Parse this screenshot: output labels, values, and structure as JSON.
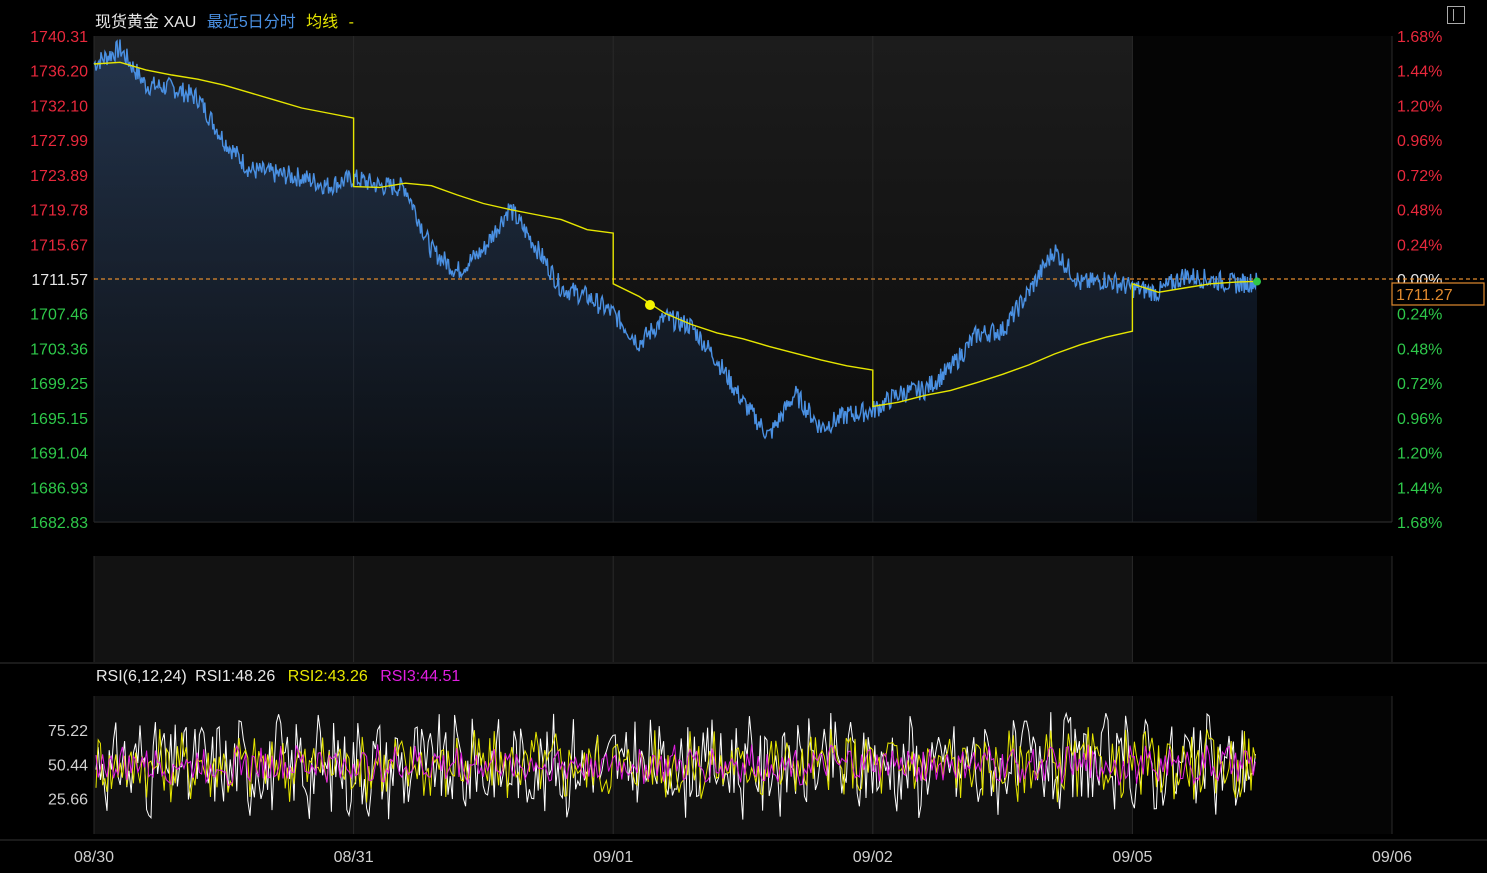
{
  "header": {
    "instrument": "现货黄金 XAU",
    "period": "最近5日分时",
    "avg_label": "均线",
    "avg_marker": "-"
  },
  "rsi_header": {
    "name": "RSI(6,12,24)",
    "rsi1": "RSI1:48.26",
    "rsi2": "RSI2:43.26",
    "rsi3": "RSI3:44.51"
  },
  "colors": {
    "price_line": "#4a90e2",
    "avg_line": "#e6e600",
    "up": "#e8283c",
    "down": "#2ec84a",
    "rsi1": "#ffffff",
    "rsi2": "#e6e600",
    "rsi3": "#e01ee0",
    "prev_close_line": "#e08a2e",
    "grid": "#2a2a2a"
  },
  "chart_data": [
    {
      "type": "line",
      "title": "现货黄金 XAU 最近5日分时",
      "x_categories": [
        "08/30",
        "08/31",
        "09/01",
        "09/02",
        "09/05",
        "09/06"
      ],
      "prev_close": 1711.57,
      "last_price": "1711.27",
      "ylim": [
        1682.83,
        1740.31
      ],
      "y_ticks_left": [
        "1740.31",
        "1736.20",
        "1732.10",
        "1727.99",
        "1723.89",
        "1719.78",
        "1715.67",
        "1711.57",
        "1707.46",
        "1703.36",
        "1699.25",
        "1695.15",
        "1691.04",
        "1686.93",
        "1682.83"
      ],
      "y_ticks_right": [
        "1.68%",
        "1.44%",
        "1.20%",
        "0.96%",
        "0.72%",
        "0.48%",
        "0.24%",
        "0.00%",
        "0.24%",
        "0.48%",
        "0.72%",
        "0.96%",
        "1.20%",
        "1.44%",
        "1.68%"
      ],
      "series": [
        {
          "name": "现货黄金 XAU",
          "x": [
            0.0,
            0.1,
            0.2,
            0.3,
            0.4,
            0.5,
            0.6,
            0.7,
            0.8,
            0.9,
            1.0,
            1.1,
            1.2,
            1.3,
            1.4,
            1.5,
            1.6,
            1.7,
            1.8,
            1.9,
            2.0,
            2.1,
            2.2,
            2.3,
            2.4,
            2.5,
            2.6,
            2.7,
            2.8,
            2.9,
            3.0,
            3.1,
            3.2,
            3.3,
            3.4,
            3.5,
            3.6,
            3.7,
            3.8,
            3.9,
            4.0,
            4.1,
            4.2,
            4.3,
            4.4,
            4.48
          ],
          "values": [
            1737.0,
            1738.8,
            1734.5,
            1734.2,
            1733.0,
            1728.0,
            1724.5,
            1724.0,
            1723.6,
            1722.6,
            1723.5,
            1722.6,
            1722.4,
            1715.0,
            1712.5,
            1715.0,
            1720.0,
            1715.5,
            1710.5,
            1709.5,
            1707.5,
            1704.0,
            1707.0,
            1706.0,
            1702.0,
            1697.0,
            1693.0,
            1698.0,
            1694.0,
            1695.5,
            1696.0,
            1698.0,
            1698.5,
            1701.0,
            1705.0,
            1705.5,
            1710.0,
            1715.0,
            1711.0,
            1711.5,
            1710.5,
            1710.0,
            1712.0,
            1711.5,
            1711.0,
            1711.27
          ]
        },
        {
          "name": "均线",
          "x": [
            0.0,
            0.1,
            0.2,
            0.3,
            0.4,
            0.5,
            0.6,
            0.7,
            0.8,
            0.9,
            1.0,
            1.0,
            1.1,
            1.2,
            1.3,
            1.4,
            1.5,
            1.6,
            1.7,
            1.8,
            1.9,
            2.0,
            2.0,
            2.1,
            2.2,
            2.3,
            2.4,
            2.5,
            2.6,
            2.7,
            2.8,
            2.9,
            3.0,
            3.0,
            3.1,
            3.2,
            3.3,
            3.4,
            3.5,
            3.6,
            3.7,
            3.8,
            3.9,
            4.0,
            4.0,
            4.1,
            4.2,
            4.3,
            4.4,
            4.48
          ],
          "values": [
            1737.0,
            1737.2,
            1736.3,
            1735.7,
            1735.2,
            1734.5,
            1733.6,
            1732.7,
            1731.8,
            1731.2,
            1730.6,
            1722.5,
            1722.4,
            1722.9,
            1722.6,
            1721.5,
            1720.5,
            1719.8,
            1719.2,
            1718.6,
            1717.4,
            1717.0,
            1711.0,
            1709.5,
            1707.5,
            1706.2,
            1705.2,
            1704.5,
            1703.6,
            1702.8,
            1702.0,
            1701.3,
            1700.8,
            1696.5,
            1697.0,
            1697.8,
            1698.4,
            1699.3,
            1700.3,
            1701.4,
            1702.7,
            1703.8,
            1704.7,
            1705.4,
            1711.0,
            1710.0,
            1710.5,
            1711.0,
            1711.2,
            1711.3
          ]
        }
      ]
    },
    {
      "type": "line",
      "title": "RSI(6,12,24)",
      "x_categories": [
        "08/30",
        "08/31",
        "09/01",
        "09/02",
        "09/05",
        "09/06"
      ],
      "ylim": [
        0,
        100
      ],
      "y_ticks": [
        "75.22",
        "50.44",
        "25.66"
      ],
      "series": [
        {
          "name": "RSI1",
          "last": 48.26
        },
        {
          "name": "RSI2",
          "last": 43.26
        },
        {
          "name": "RSI3",
          "last": 44.51
        }
      ]
    }
  ]
}
